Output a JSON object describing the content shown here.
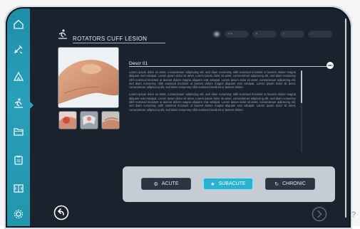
{
  "header": {
    "title": "ROTATORS CUFF LESION",
    "icon": "exercise-figure-icon"
  },
  "toolbar": {
    "items": [
      "record-icon",
      "people-icon",
      "figure-icon",
      "contrast-icon",
      "circle-icon"
    ]
  },
  "sidebar": {
    "items": [
      {
        "name": "home-icon"
      },
      {
        "name": "pen-icon"
      },
      {
        "name": "triangle-ruler-icon"
      },
      {
        "name": "exercise-figure-icon",
        "active": true
      },
      {
        "name": "folder-icon"
      },
      {
        "name": "clipboard-icon"
      },
      {
        "name": "split-screen-icon"
      },
      {
        "name": "settings-icon"
      }
    ]
  },
  "description": {
    "heading": "Descr 01",
    "paragraphs": [
      "Lorem ipsum dolor sit amet, consectetuer adipiscing elit, sed diam nonummy nibh euismod tincidunt ut laoreet dolore magna aliquam erat volutpat. Lorem ipsum dolor sit amet, Lorem ipsum dolor sit amet, consectetuer adipiscing elit, sed diam nonummy nibh euismod tincidunt ut laoreet dolore magna aliquam erat volutpat. Lorem ipsum dolor sit amet, consectetuer adipiscing elit, sed diam nonummy nibh euismod tincidunt ut laoreet dolore magna aliquam erat volutpat. Lorem ipsum dolor sit amet, consectetuer adipiscing elit, sed diam nonummy nibh euismod tincidunt ut laoreet dolore.",
      "Lorem ipsum dolor sit amet, consectetuer adipiscing elit, sed diam nonummy nibh euismod tincidunt ut laoreet dolore magna aliquam erat volutpat. Lorem ipsum dolor sit amet, Lorem ipsum dolor sit amet, consectetuer adipiscing elit, sed diam nonummy nibh euismod tincidunt ut laoreet dolore magna aliquam erat volutpat. Lorem ipsum dolor sit amet, consectetuer adipiscing elit, sed diam nonummy nibh euismod tincidunt ut laoreet dolore magna aliquam erat volutpat. Lorem ipsum dolor sit amet, consectetuer adipiscing elit, sed diam nonummy nibh euismod tincidunt ut laoreet dolore."
    ]
  },
  "phases": [
    {
      "label": "ACUTE",
      "icon": "gear-icon",
      "active": false
    },
    {
      "label": "SUBACUTE",
      "icon": "exercise-figure-icon",
      "active": true
    },
    {
      "label": "CHRONIC",
      "icon": "cycle-icon",
      "active": false
    }
  ],
  "colors": {
    "accent": "#2ab3d0",
    "sidebar": "#2196ad",
    "background": "#1a222e"
  }
}
